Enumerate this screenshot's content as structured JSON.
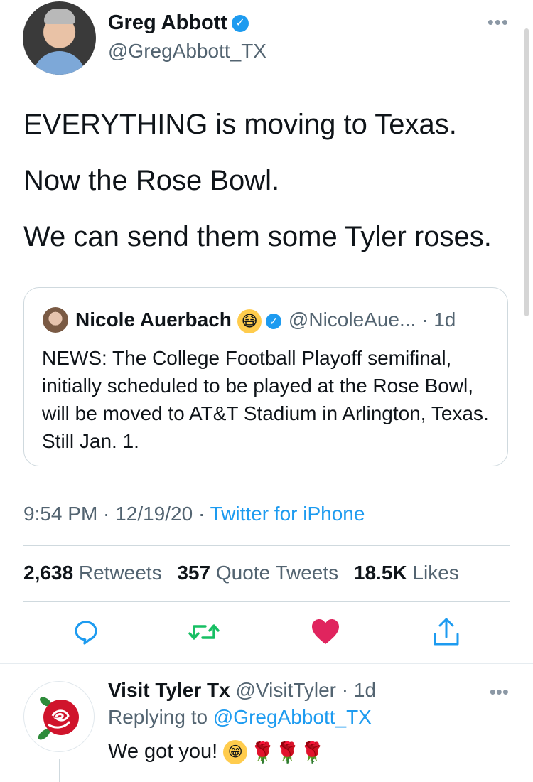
{
  "tweet": {
    "author_name": "Greg Abbott",
    "author_handle": "@GregAbbott_TX",
    "more": "•••",
    "lines": [
      "EVERYTHING is moving to Texas.",
      "Now the Rose Bowl.",
      "We can send them some Tyler roses."
    ],
    "quote": {
      "name": "Nicole Auerbach",
      "emoji": "😷",
      "handle": "@NicoleAue...",
      "age": "· 1d",
      "text": "NEWS: The College Football Playoff semifinal, initially scheduled to be played at the Rose Bowl, will be moved to AT&T Stadium in Arlington, Texas. Still Jan. 1."
    },
    "time": "9:54 PM",
    "date": "12/19/20",
    "source": "Twitter for iPhone",
    "stats": {
      "retweets_count": "2,638",
      "retweets_label": "Retweets",
      "quotes_count": "357",
      "quotes_label": "Quote Tweets",
      "likes_count": "18.5K",
      "likes_label": "Likes"
    }
  },
  "reply": {
    "name": "Visit Tyler Tx",
    "handle": "@VisitTyler",
    "age": "· 1d",
    "replying_label": "Replying to",
    "replying_to": "@GregAbbott_TX",
    "text": "We got you!",
    "emoji": "😁",
    "roses": "🌹🌹🌹",
    "more": "•••"
  },
  "colors": {
    "link_blue": "#1d9bf0",
    "retweet_green": "#17bf63",
    "like_red": "#e0245e",
    "secondary_text": "#536471"
  },
  "icons": [
    "verified-badge-icon",
    "reply-icon",
    "retweet-icon",
    "like-heart-icon",
    "share-icon",
    "rose-logo-icon"
  ]
}
